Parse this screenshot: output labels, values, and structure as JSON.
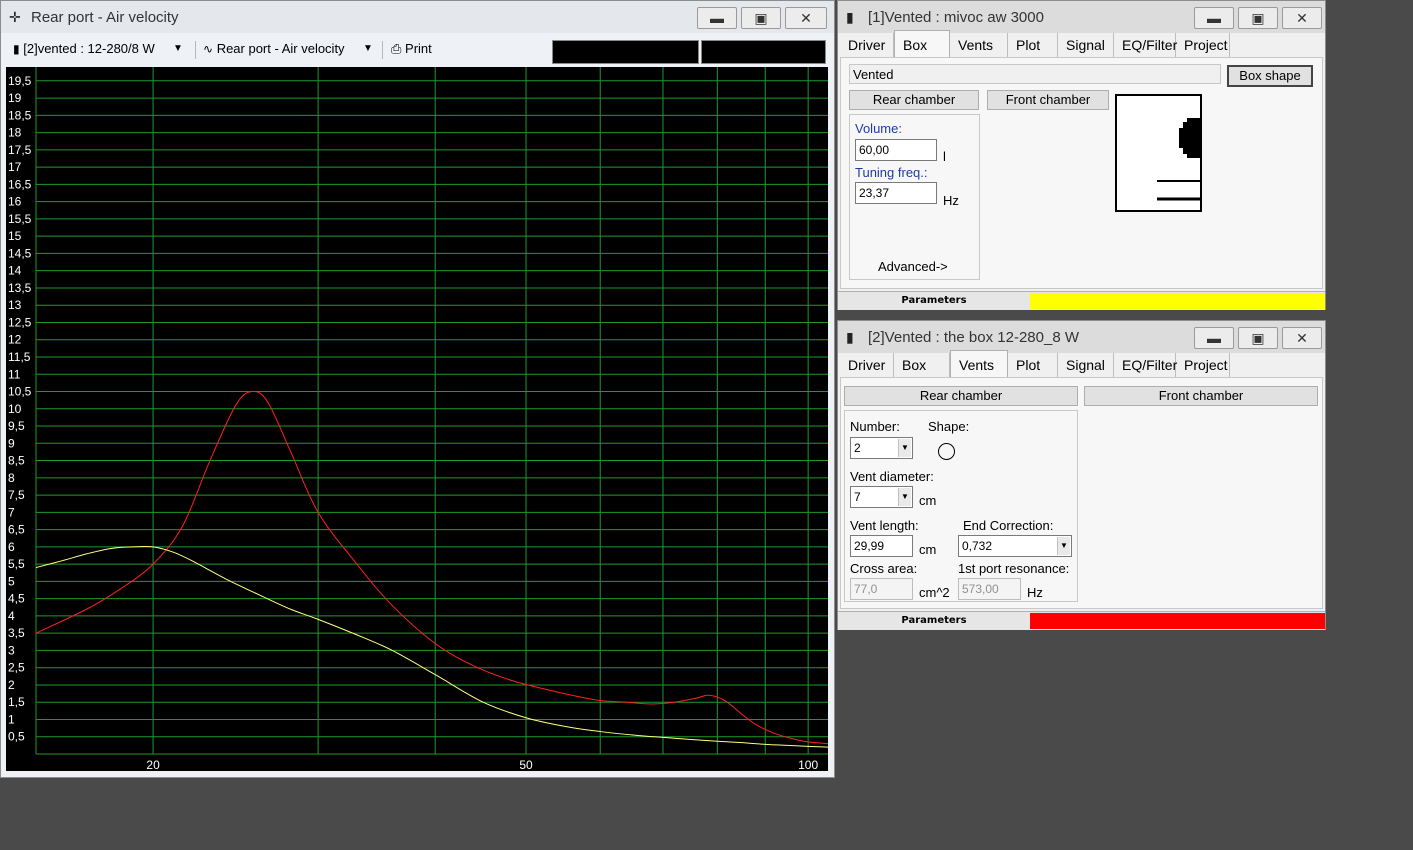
{
  "graph_window": {
    "title": "Rear port - Air velocity",
    "toolbar": {
      "box_select": "[2]vented : 12-280/8 W",
      "plot_select": "Rear port - Air velocity",
      "print_label": "Print"
    }
  },
  "win1": {
    "title": "[1]Vented : mivoc aw 3000",
    "tabs": [
      "Driver",
      "Box",
      "Vents",
      "Plot",
      "Signal",
      "EQ/Filter",
      "Project"
    ],
    "active_tab": "Box",
    "box_type": "Vented",
    "box_shape_button": "Box shape",
    "rear_chamber_button": "Rear chamber",
    "front_chamber_button": "Front chamber",
    "volume_label": "Volume:",
    "volume_value": "60,00",
    "volume_unit": "l",
    "tuning_label": "Tuning freq.:",
    "tuning_value": "23,37",
    "tuning_unit": "Hz",
    "advanced_label": "Advanced->",
    "status_label": "Parameters",
    "status_color": "#ffff00"
  },
  "win2": {
    "title": "[2]Vented : the box 12-280_8 W",
    "tabs": [
      "Driver",
      "Box",
      "Vents",
      "Plot",
      "Signal",
      "EQ/Filter",
      "Project"
    ],
    "active_tab": "Vents",
    "rear_chamber_button": "Rear chamber",
    "front_chamber_button": "Front chamber",
    "number_label": "Number:",
    "number_value": "2",
    "shape_label": "Shape:",
    "vent_diameter_label": "Vent diameter:",
    "vent_diameter_value": "7",
    "vent_diameter_unit": "cm",
    "vent_length_label": "Vent length:",
    "vent_length_value": "29,99",
    "vent_length_unit": "cm",
    "end_correction_label": "End Correction:",
    "end_correction_value": "0,732",
    "cross_area_label": "Cross area:",
    "cross_area_value": "77,0",
    "cross_area_unit": "cm^2",
    "port_resonance_label": "1st port resonance:",
    "port_resonance_value": "573,00",
    "port_resonance_unit": "Hz",
    "status_label": "Parameters",
    "status_color": "#ff0000"
  },
  "chart_data": {
    "type": "line",
    "xscale": "log",
    "xlim": [
      15,
      105
    ],
    "ylim": [
      0,
      19.9
    ],
    "grid": true,
    "x_ticks": [
      20,
      50,
      100
    ],
    "y_ticks": [
      "0,5",
      "1",
      "1,5",
      "2",
      "2,5",
      "3",
      "3,5",
      "4",
      "4,5",
      "5",
      "5,5",
      "6",
      "6,5",
      "7",
      "7,5",
      "8",
      "8,5",
      "9",
      "9,5",
      "10",
      "10,5",
      "11",
      "11,5",
      "12",
      "12,5",
      "13",
      "13,5",
      "14",
      "14,5",
      "15",
      "15,5",
      "16",
      "16,5",
      "17",
      "17,5",
      "18",
      "18,5",
      "19",
      "19,5"
    ],
    "series": [
      {
        "color": "#ff2020",
        "x": [
          15,
          17,
          18.5,
          20,
          21.5,
          23,
          24.5,
          25.5,
          26.5,
          28,
          30,
          33,
          36,
          40,
          44,
          48,
          52,
          56,
          60,
          64,
          68,
          72,
          76,
          78,
          80,
          82,
          85,
          88,
          92,
          96,
          100,
          105
        ],
        "y": [
          3.5,
          4.2,
          4.8,
          5.5,
          6.6,
          8.5,
          10.1,
          10.5,
          10.2,
          8.8,
          7.0,
          5.5,
          4.3,
          3.2,
          2.55,
          2.15,
          1.9,
          1.7,
          1.55,
          1.5,
          1.45,
          1.5,
          1.62,
          1.7,
          1.65,
          1.5,
          1.15,
          0.85,
          0.6,
          0.45,
          0.35,
          0.3
        ]
      },
      {
        "color": "#ffff80",
        "x": [
          15,
          16,
          17,
          18,
          19,
          20,
          21,
          22,
          24,
          26,
          28,
          30,
          33,
          36,
          40,
          45,
          50,
          55,
          60,
          65,
          70,
          75,
          80,
          85,
          90,
          95,
          100,
          105
        ],
        "y": [
          5.4,
          5.6,
          5.8,
          5.95,
          6.0,
          6.0,
          5.85,
          5.6,
          5.05,
          4.6,
          4.2,
          3.9,
          3.45,
          3.0,
          2.3,
          1.5,
          1.05,
          0.8,
          0.65,
          0.55,
          0.48,
          0.42,
          0.37,
          0.33,
          0.28,
          0.25,
          0.22,
          0.2
        ]
      }
    ]
  }
}
